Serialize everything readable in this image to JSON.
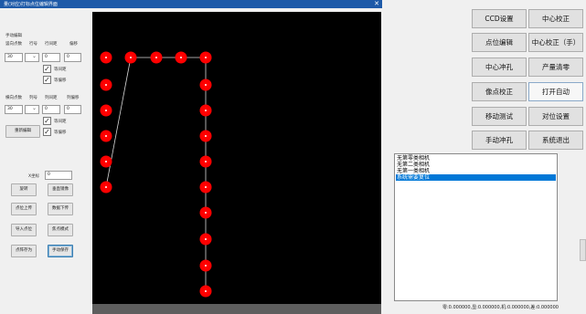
{
  "window": {
    "title": "量(对应)打标点位编辑界面",
    "close_glyph": "✕"
  },
  "left_panel": {
    "group_title": "手动编辑",
    "row1": {
      "headers": [
        "竖向点数",
        "行号",
        "行间距",
        "偏移"
      ],
      "count": "30",
      "line_number": "",
      "spacing": "0",
      "offset": "0"
    },
    "row2": {
      "headers": [
        "横向点数",
        "列号",
        "列间距",
        "列偏移"
      ],
      "count": "30",
      "line_number": "",
      "spacing": "0",
      "offset": "0"
    },
    "checkboxes": [
      {
        "label": "等间距",
        "checked": true
      },
      {
        "label": "等偏移",
        "checked": true
      },
      {
        "label": "等间距",
        "checked": true
      },
      {
        "label": "等偏移",
        "checked": true
      }
    ],
    "redo_button": "重新编辑",
    "x_coord_label": "X坐标",
    "x_coord_value": "0",
    "buttons": [
      "旋转",
      "垂直镜像",
      "点位上传",
      "数据下传",
      "导入点位",
      "焦点模式",
      "点阵存为",
      "手动保存"
    ]
  },
  "right_panel": {
    "buttons": [
      {
        "label": "CCD设置",
        "active": false
      },
      {
        "label": "中心校正",
        "active": false
      },
      {
        "label": "点位编辑",
        "active": false
      },
      {
        "label": "中心校正（手）",
        "active": false
      },
      {
        "label": "中心冲孔",
        "active": false
      },
      {
        "label": "产量清零",
        "active": false
      },
      {
        "label": "像点校正",
        "active": false
      },
      {
        "label": "打开自动",
        "active": true
      },
      {
        "label": "移动测试",
        "active": false
      },
      {
        "label": "对位设置",
        "active": false
      },
      {
        "label": "手动冲孔",
        "active": false
      },
      {
        "label": "系统退出",
        "active": false
      }
    ],
    "log_items": [
      {
        "text": "无第零类相机",
        "selected": false
      },
      {
        "text": "无第二类相机",
        "selected": false
      },
      {
        "text": "无第一类相机",
        "selected": false
      },
      {
        "text": "系统需要复位",
        "selected": true
      }
    ],
    "status_text": "零:0.000000,显:0.000000,机:0.000000,差:0.000000"
  },
  "canvas": {
    "background": "#000000",
    "dot_color": "#ff0000",
    "path_color": "#d9d9d9"
  },
  "colors": {
    "titlebar": "#1e5aa8",
    "selection": "#0078d7"
  }
}
